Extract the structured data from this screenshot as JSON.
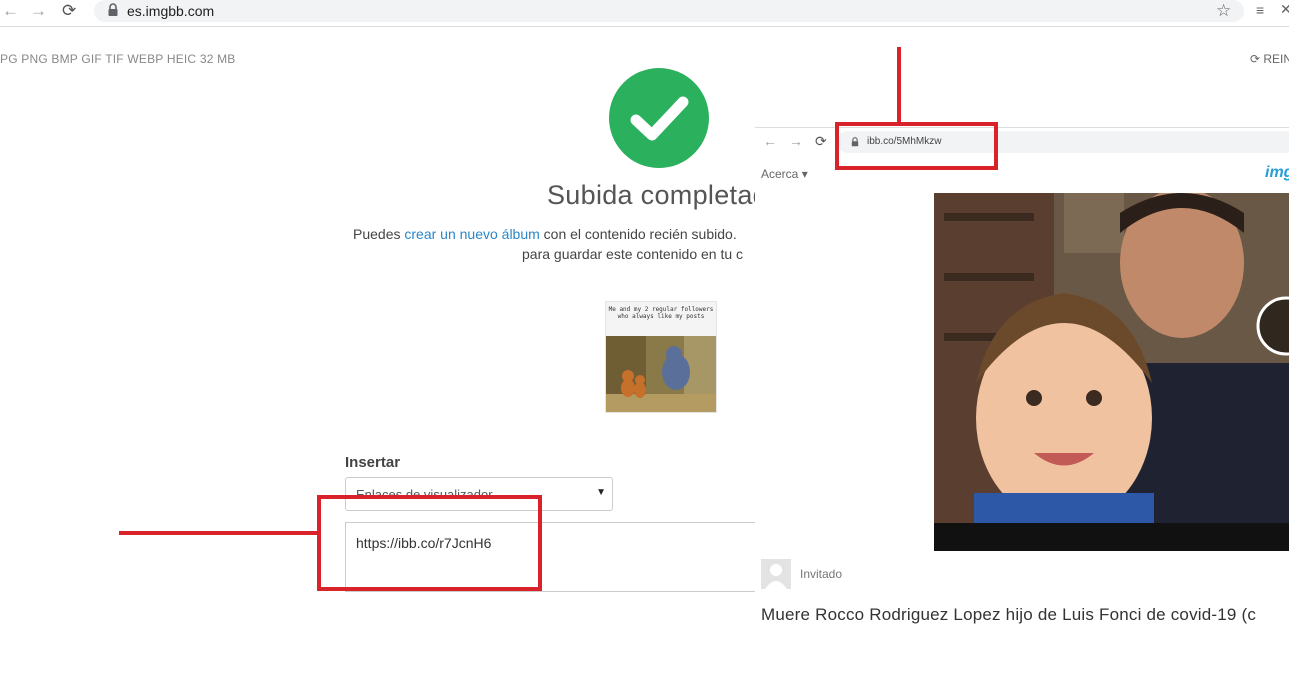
{
  "browser": {
    "url": "es.imgbb.com"
  },
  "page": {
    "formats": "PG PNG BMP GIF TIF WEBP HEIC  32 MB",
    "reset_label": "REIN",
    "title": "Subida completad",
    "line1_prefix": "Puedes ",
    "line1_link": "crear un nuevo álbum",
    "line1_suffix": " con el contenido recién subido.",
    "line2": "para guardar este contenido en tu c",
    "thumb_caption": "Me and my 2 regular followers who always like my posts"
  },
  "embed": {
    "label": "Insertar",
    "select_value": "Enlaces de visualizador",
    "link_value": "https://ibb.co/r7JcnH6"
  },
  "overlay": {
    "url": "ibb.co/5MhMkzw",
    "menu_label": "Acerca",
    "logo": "img",
    "user": "Invitado",
    "headline": "Muere Rocco Rodriguez Lopez hijo de Luis Fonci de covid-19 (c"
  },
  "colors": {
    "accent": "#2a87c8",
    "success": "#2bb05d",
    "annotation": "#d8232a"
  },
  "icons": [
    "back-icon",
    "forward-icon",
    "reload-icon",
    "lock-icon",
    "star-icon",
    "check-icon",
    "caret-down-icon",
    "user-icon"
  ]
}
